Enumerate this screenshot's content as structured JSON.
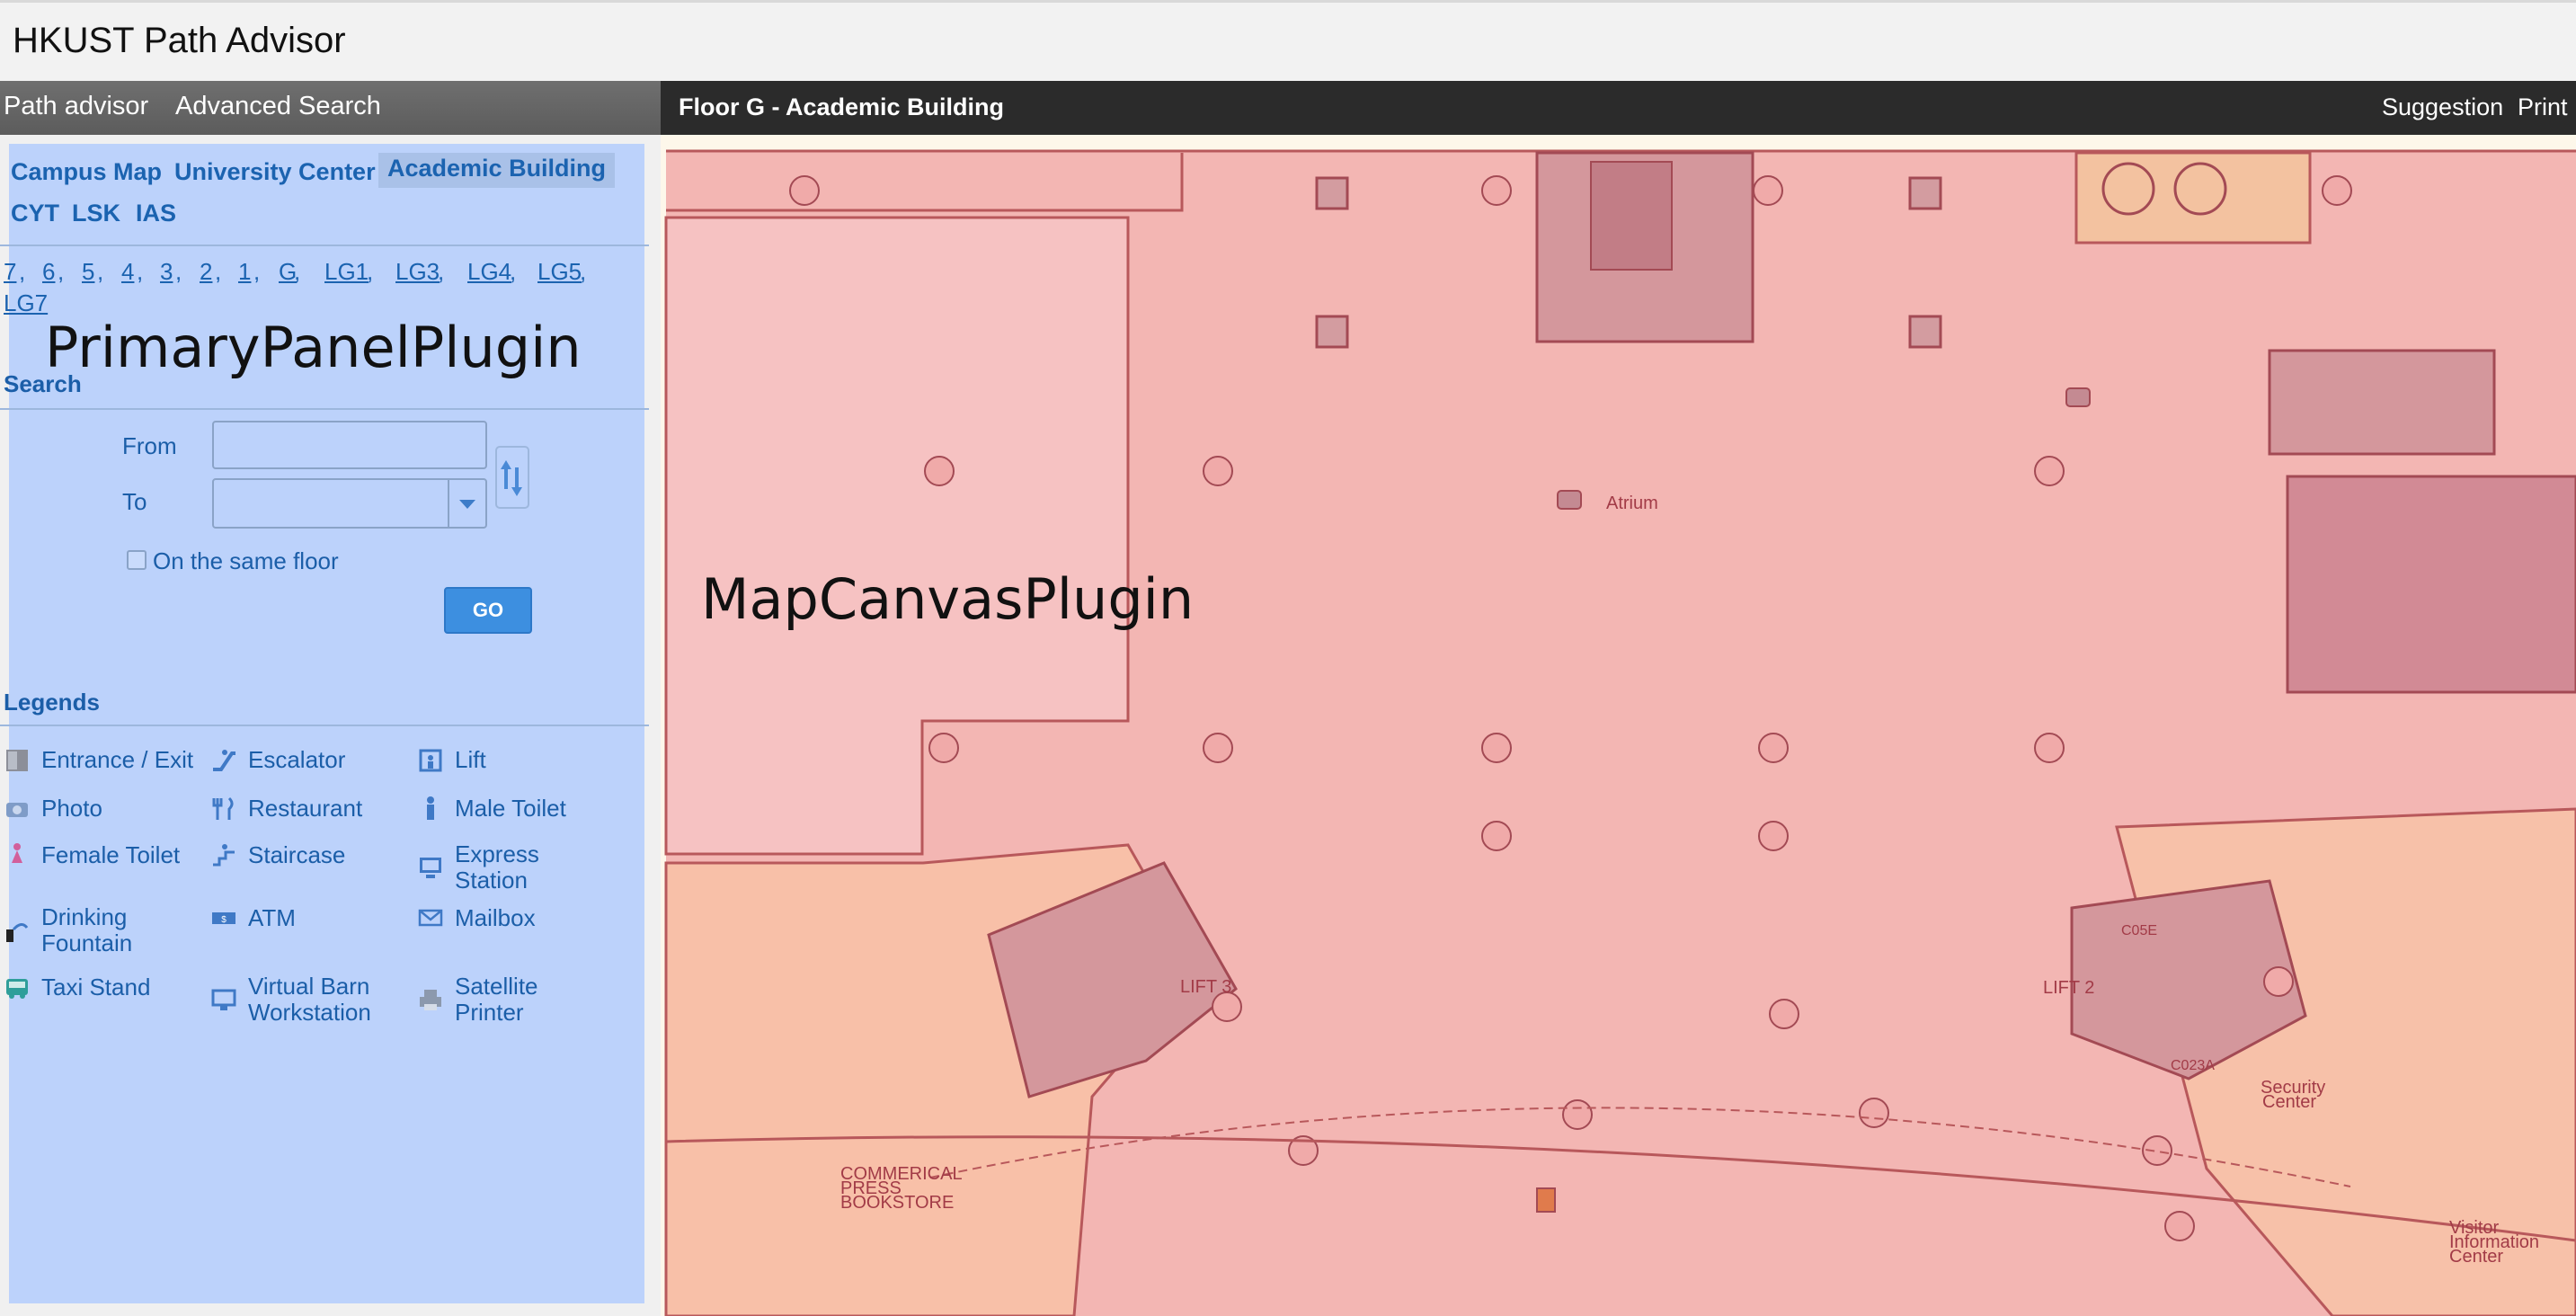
{
  "app": {
    "title": "HKUST Path Advisor"
  },
  "nav": {
    "path_advisor": "Path advisor",
    "advanced_search": "Advanced Search"
  },
  "panel": {
    "tabs": {
      "campus_map": "Campus Map",
      "university_center": "University Center",
      "academic_building": "Academic Building",
      "cyt": "CYT",
      "lsk": "LSK",
      "ias": "IAS"
    },
    "floors": [
      "7",
      "6",
      "5",
      "4",
      "3",
      "2",
      "1",
      "G",
      "LG1",
      "LG3",
      "LG4",
      "LG5",
      "LG7"
    ],
    "plugin_label": "PrimaryPanelPlugin",
    "search": {
      "heading": "Search",
      "from_label": "From",
      "to_label": "To",
      "from_value": "",
      "to_value": "",
      "same_floor_label": "On the same floor",
      "same_floor_checked": false,
      "go_label": "GO"
    },
    "legends": {
      "heading": "Legends",
      "items": [
        {
          "label": "Entrance / Exit",
          "icon": "entrance-exit-icon"
        },
        {
          "label": "Escalator",
          "icon": "escalator-icon"
        },
        {
          "label": "Lift",
          "icon": "lift-icon"
        },
        {
          "label": "Photo",
          "icon": "camera-icon"
        },
        {
          "label": "Restaurant",
          "icon": "restaurant-icon"
        },
        {
          "label": "Male Toilet",
          "icon": "male-toilet-icon"
        },
        {
          "label": "Female Toilet",
          "icon": "female-toilet-icon"
        },
        {
          "label": "Staircase",
          "icon": "staircase-icon"
        },
        {
          "label": "Express\nStation",
          "icon": "express-station-icon"
        },
        {
          "label": "Drinking\nFountain",
          "icon": "drinking-fountain-icon"
        },
        {
          "label": "ATM",
          "icon": "atm-icon"
        },
        {
          "label": "Mailbox",
          "icon": "mailbox-icon"
        },
        {
          "label": "Taxi Stand",
          "icon": "taxi-stand-icon"
        },
        {
          "label": "Virtual Barn\nWorkstation",
          "icon": "workstation-icon"
        },
        {
          "label": "Satellite\nPrinter",
          "icon": "printer-icon"
        }
      ]
    }
  },
  "map": {
    "floor_title": "Floor G - Academic Building",
    "suggestion": "Suggestion",
    "print": "Print",
    "plugin_label": "MapCanvasPlugin",
    "labels": {
      "atrium": "Atrium",
      "lift3": "LIFT 3",
      "lift2": "LIFT 2",
      "bookstore": [
        "COMMERICAL",
        "PRESS",
        "BOOKSTORE"
      ],
      "security": [
        "Security",
        "Center"
      ],
      "visitor": [
        "Visitor",
        "Information",
        "Center"
      ],
      "room_c05e": "C05E",
      "room_c023a": "C023A"
    }
  },
  "colors": {
    "panel_overlay": "#bcd2fb",
    "map_overlay": "#f2b0ae",
    "accent_blue": "#1b63b0",
    "go_button": "#3d8fe0"
  }
}
